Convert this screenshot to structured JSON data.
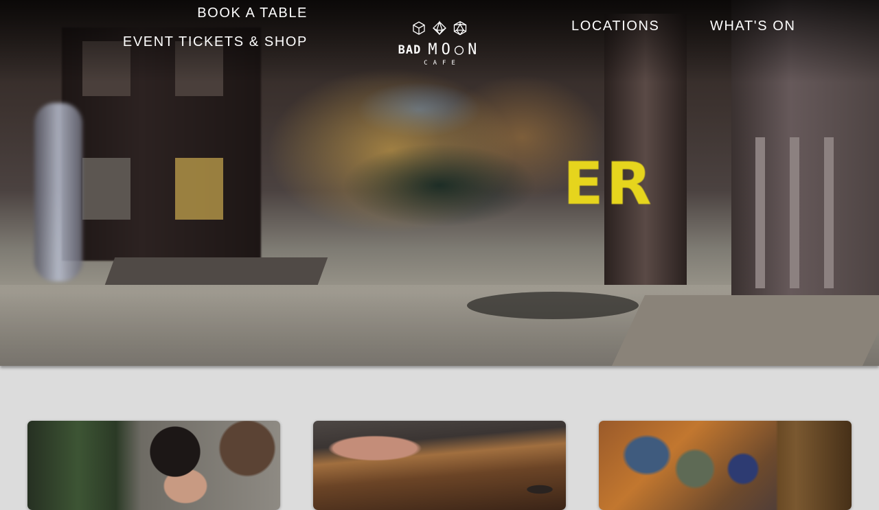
{
  "nav": {
    "book_a_table": "BOOK A TABLE",
    "event_tickets_shop": "EVENT TICKETS & SHOP",
    "locations": "LOCATIONS",
    "whats_on": "WHAT'S ON"
  },
  "logo": {
    "word_bad": "BAD",
    "word_moon": "MO○N",
    "word_cafe": "CAFE",
    "icons": [
      "cube-die-icon",
      "d8-die-icon",
      "d20-die-icon"
    ]
  },
  "hero": {
    "visible_text": "ER",
    "accent_color": "#e6d51d"
  },
  "cards": [
    {
      "name": "card-people-playing"
    },
    {
      "name": "card-hands-on-table"
    },
    {
      "name": "card-wargaming-shelf"
    }
  ]
}
